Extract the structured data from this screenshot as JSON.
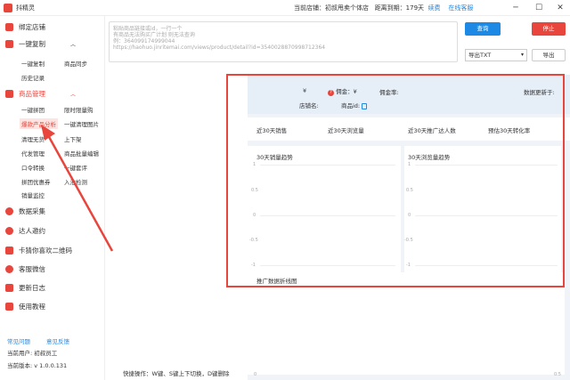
{
  "app": {
    "title": "抖精灵"
  },
  "status": {
    "store_label": "当前店铺：初叔甩卖个体店",
    "expiry_label": "距离到期：179天",
    "renew": "续费",
    "support": "在线客服"
  },
  "sidebar": {
    "bind_store": "绑定店铺",
    "one_click_copy": "一键复制",
    "copy_items": [
      "一键复制",
      "商品同步",
      "历史记录"
    ],
    "product_mgmt": "商品管理",
    "mgmt_items": [
      "一键拼团",
      "限时限量购",
      "爆款产品分析",
      "一键清理图片",
      "清理无货",
      "上下架",
      "代发管理",
      "商品批量编辑",
      "口令转换",
      "一键套评",
      "拼团优惠券",
      "入池检测",
      "销量监控"
    ],
    "data_collect": "数据采集",
    "influencer": "达人邀约",
    "qrcode": "卡猜你喜欢二维码",
    "service_wechat": "客服微信",
    "update_log": "更新日志",
    "tutorial": "使用教程",
    "faq": "常见问题",
    "feedback": "意见反馈",
    "current_user": "当前用户: 初叔员工",
    "version": "当前版本: v 1.0.0.131"
  },
  "search": {
    "placeholder_lines": [
      "粘贴商品链接或id，一行一个",
      "有商品无法购买广计划 则无法查询",
      "例：364099174999044",
      "https://haohuo.jinritemai.com/views/product/detail?id=3540028870998712364"
    ],
    "search_btn": "查询",
    "stop_btn": "停止",
    "export_select": "导出TXT",
    "export_btn": "导出"
  },
  "info": {
    "price_symbol": "¥",
    "commission_label": "佣金：¥",
    "commission_rate_label": "佣金率:",
    "update_time_label": "数据更新于:",
    "shop_name_label": "店铺名:",
    "product_id_label": "商品id:"
  },
  "stats": [
    "近30天销售",
    "近30天浏览量",
    "近30天推广达人数",
    "预估30天转化率"
  ],
  "charts": {
    "sales_trend": "30天销量趋势",
    "views_trend": "30天浏览量趋势",
    "promo_trend": "推广数据折线图",
    "y_ticks": [
      "1",
      "0.5",
      "0",
      "-0.5",
      "-1"
    ],
    "x_ticks": [
      "0",
      "0.5"
    ]
  },
  "shortcut_hint": "快捷操作：W键、S键上下切换，D键删除",
  "colors": {
    "accent": "#e8453c",
    "blue": "#1e88e5"
  }
}
